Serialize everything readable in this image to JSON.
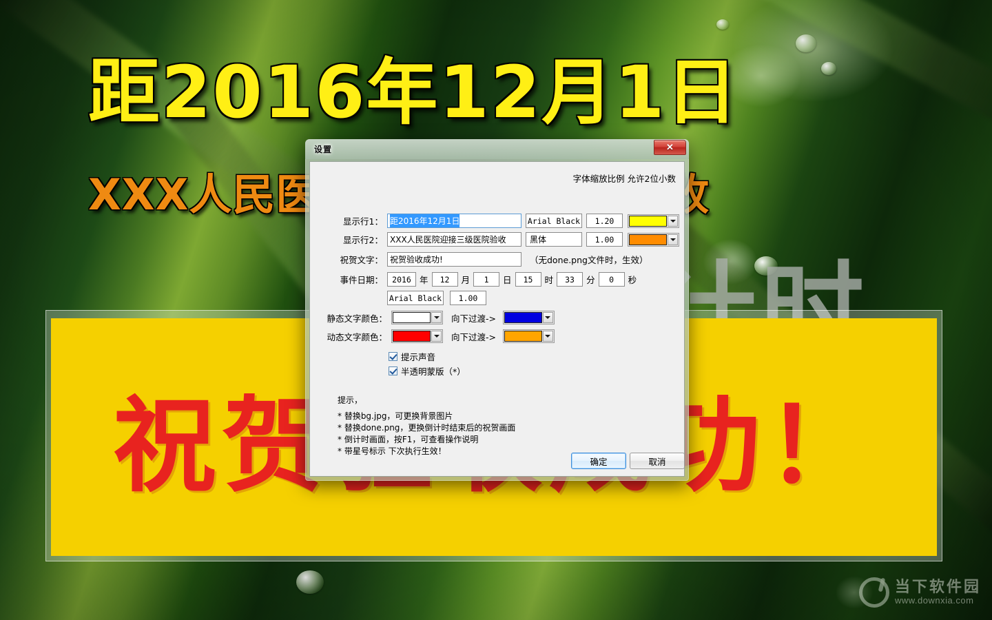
{
  "countdown": {
    "line1": "距2016年12月1日",
    "line2": "XXX人民医院迎接三级医院验收",
    "ghost": "倒计时",
    "banner_text": "祝贺验收成功！"
  },
  "watermark": {
    "name": "当下软件园",
    "url": "www.downxia.com"
  },
  "dialog": {
    "title": "设置",
    "close_icon": "close-icon",
    "scale_note": "字体缩放比例 允许2位小数",
    "rows": {
      "line1": {
        "label": "显示行1：",
        "value": "距2016年12月1日",
        "font": "Arial Black",
        "scale": "1.20",
        "color": "#ffff00"
      },
      "line2": {
        "label": "显示行2：",
        "value": "XXX人民医院迎接三级医院验收",
        "font": "黑体",
        "scale": "1.00",
        "color": "#ff8c00"
      },
      "congrats": {
        "label": "祝贺文字：",
        "value": "祝贺验收成功!",
        "note": "（无done.png文件时，生效）"
      },
      "date": {
        "label": "事件日期：",
        "year": "2016",
        "year_unit": "年",
        "month": "12",
        "month_unit": "月",
        "day": "1",
        "day_unit": "日",
        "hour": "15",
        "hour_unit": "时",
        "minute": "33",
        "minute_unit": "分",
        "second": "0",
        "second_unit": "秒",
        "font": "Arial Black",
        "scale": "1.00"
      },
      "static_color": {
        "label": "静态文字颜色：",
        "color": "#ffffff",
        "transition_label": "向下过渡->",
        "to_color": "#0000e0"
      },
      "dynamic_color": {
        "label": "动态文字颜色：",
        "color": "#ff0000",
        "transition_label": "向下过渡->",
        "to_color": "#ffa500"
      }
    },
    "checkboxes": [
      {
        "label": "提示声音",
        "checked": true
      },
      {
        "label": "半透明蒙版（*）",
        "checked": true
      }
    ],
    "tips": {
      "heading": "提示，",
      "items": [
        "* 替换bg.jpg，可更换背景图片",
        "* 替换done.png，更换倒计时结束后的祝贺画面",
        "* 倒计时画面，按F1，可查看操作说明",
        "* 带星号标示 下次执行生效！"
      ]
    },
    "buttons": {
      "ok": "确定",
      "cancel": "取消"
    }
  }
}
